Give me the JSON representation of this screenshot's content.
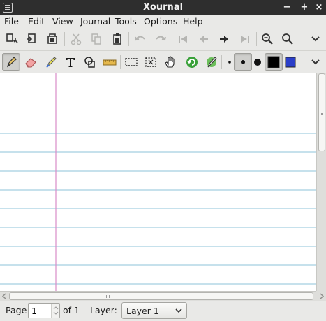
{
  "window": {
    "title": "Xournal",
    "minimize_glyph": "−",
    "maximize_glyph": "+",
    "close_glyph": "×"
  },
  "menubar": {
    "file": "File",
    "edit": "Edit",
    "view": "View",
    "journal": "Journal",
    "tools": "Tools",
    "options": "Options",
    "help": "Help"
  },
  "toolbar_main": {
    "icons": [
      "save-icon",
      "open-icon",
      "copy-page-icon",
      "cut-icon",
      "copy-icon",
      "paste-icon",
      "undo-icon",
      "redo-icon",
      "first-page-icon",
      "previous-page-icon",
      "next-page-icon",
      "last-page-icon",
      "zoom-out-icon",
      "zoom-in-icon",
      "overflow-chevron-icon"
    ]
  },
  "toolbar_tools": {
    "icons": [
      "pen-icon",
      "eraser-icon",
      "highlighter-icon",
      "text-icon",
      "shape-recognizer-icon",
      "ruler-icon",
      "rect-select-icon",
      "region-select-icon",
      "hand-icon",
      "default-tools-icon",
      "default-pen-icon",
      "thin-dot-icon",
      "medium-dot-icon",
      "thick-dot-icon",
      "black-color-icon",
      "blue-color-icon",
      "overflow-chevron-icon"
    ],
    "colors": {
      "black": "#000000",
      "blue": "#2b3fc9"
    }
  },
  "page": {
    "background": "#ffffff",
    "rule_color": "#8cc3d8",
    "margin_color": "#d98cc9"
  },
  "status": {
    "page_label": "Page",
    "page_value": "1",
    "of_label": "of 1",
    "layer_label": "Layer:",
    "layer_value": "Layer 1"
  }
}
